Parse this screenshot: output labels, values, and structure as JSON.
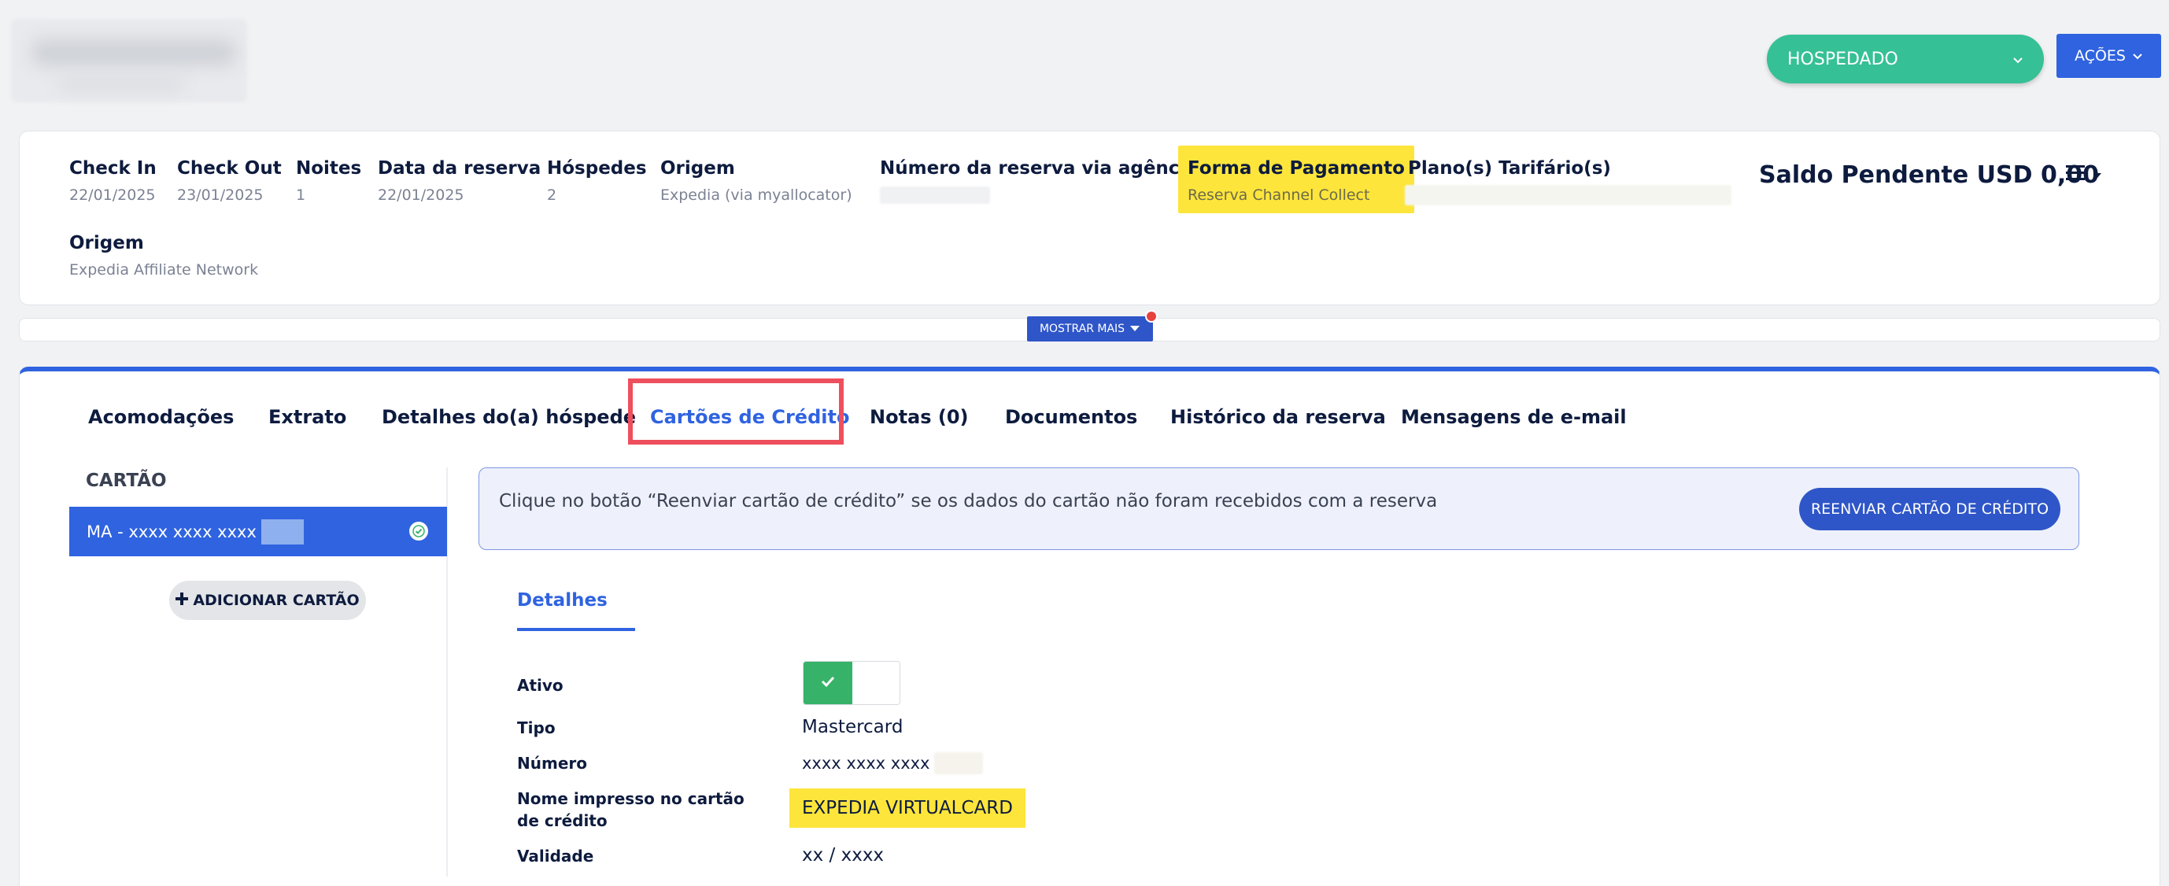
{
  "header": {
    "status": "HOSPEDADO",
    "actions_label": "AÇÕES"
  },
  "summary": {
    "checkin": {
      "label": "Check In",
      "value": "22/01/2025"
    },
    "checkout": {
      "label": "Check Out",
      "value": "23/01/2025"
    },
    "noites": {
      "label": "Noites",
      "value": "1"
    },
    "data_reserva": {
      "label": "Data da reserva",
      "value": "22/01/2025"
    },
    "hospedes": {
      "label": "Hóspedes",
      "value": "2"
    },
    "origem": {
      "label": "Origem",
      "value": "Expedia (via myallocator)"
    },
    "numero_agencia": {
      "label": "Número da reserva via agência"
    },
    "forma_pagamento": {
      "label": "Forma de Pagamento",
      "value": "Reserva Channel Collect"
    },
    "planos": {
      "label": "Plano(s) Tarifário(s)"
    },
    "origem2": {
      "label": "Origem",
      "value": "Expedia Affiliate Network"
    },
    "saldo": "Saldo Pendente USD 0,00",
    "show_more": "MOSTRAR MAIS"
  },
  "tabs": [
    {
      "label": "Acomodações"
    },
    {
      "label": "Extrato"
    },
    {
      "label": "Detalhes do(a) hóspede"
    },
    {
      "label": "Cartões de Crédito"
    },
    {
      "label": "Notas (0)"
    },
    {
      "label": "Documentos"
    },
    {
      "label": "Histórico da reserva"
    },
    {
      "label": "Mensagens de e-mail"
    }
  ],
  "cards_panel": {
    "heading": "CARTÃO",
    "card_item": "MA - xxxx xxxx xxxx",
    "add_card": "ADICIONAR CARTÃO"
  },
  "info": {
    "text": "Clique no botão “Reenviar cartão de crédito” se os dados do cartão não foram recebidos com a reserva",
    "resend_button": "REENVIAR CARTÃO DE CRÉDITO"
  },
  "details": {
    "tab": "Detalhes",
    "ativo_label": "Ativo",
    "ativo_value": true,
    "tipo_label": "Tipo",
    "tipo_value": "Mastercard",
    "numero_label": "Número",
    "numero_value": "xxxx xxxx xxxx",
    "nome_label": "Nome impresso no cartão de crédito",
    "nome_value": "EXPEDIA VIRTUALCARD",
    "validade_label": "Validade",
    "validade_value": "xx / xxxx"
  },
  "colors": {
    "primary": "#2f63e0",
    "status_green": "#36c095",
    "highlight_yellow": "#fde53b",
    "annotation_red": "#ee4f5c"
  }
}
